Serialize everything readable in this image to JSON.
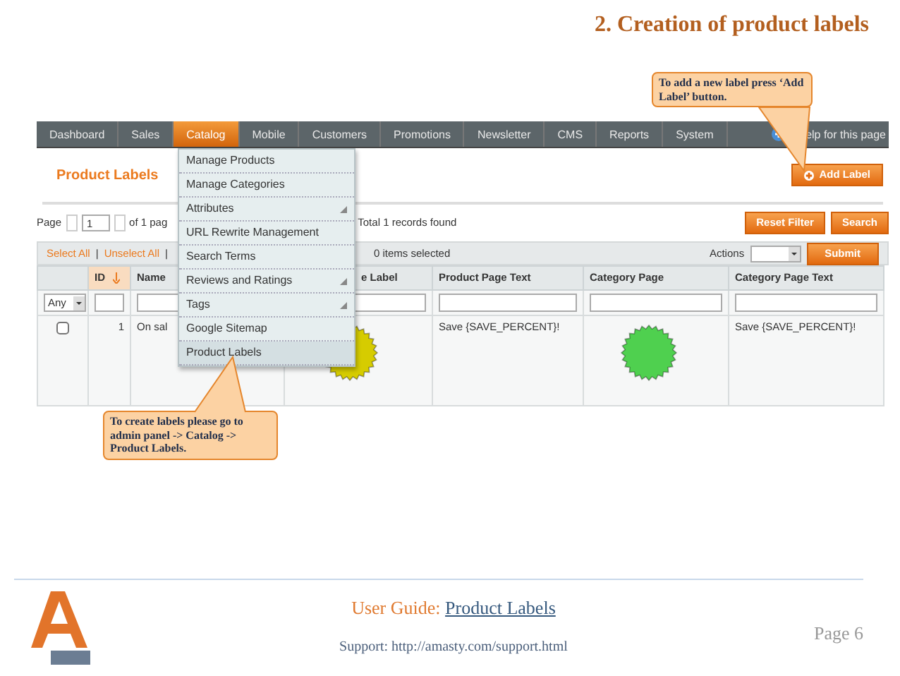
{
  "slide_title": "2. Creation of product labels",
  "admin": {
    "nav": [
      {
        "label": "Dashboard",
        "selected": false
      },
      {
        "label": "Sales",
        "selected": false
      },
      {
        "label": "Catalog",
        "selected": true
      },
      {
        "label": "Mobile",
        "selected": false
      },
      {
        "label": "Customers",
        "selected": false
      },
      {
        "label": "Promotions",
        "selected": false
      },
      {
        "label": "Newsletter",
        "selected": false
      },
      {
        "label": "CMS",
        "selected": false
      },
      {
        "label": "Reports",
        "selected": false
      },
      {
        "label": "System",
        "selected": false
      }
    ],
    "help_link": "elp for this page",
    "menu": [
      {
        "label": "Manage Products",
        "submenu": false,
        "selected": false
      },
      {
        "label": "Manage Categories",
        "submenu": false,
        "selected": false
      },
      {
        "label": "Attributes",
        "submenu": true,
        "selected": false
      },
      {
        "label": "URL Rewrite Management",
        "submenu": false,
        "selected": false
      },
      {
        "label": "Search Terms",
        "submenu": false,
        "selected": false
      },
      {
        "label": "Reviews and Ratings",
        "submenu": true,
        "selected": false
      },
      {
        "label": "Tags",
        "submenu": true,
        "selected": false
      },
      {
        "label": "Google Sitemap",
        "submenu": false,
        "selected": false
      },
      {
        "label": "Product Labels",
        "submenu": false,
        "selected": true
      }
    ],
    "page_title": "Product Labels",
    "add_button": "Add Label",
    "pager": {
      "page_label": "Page",
      "page_value": "1",
      "of_pages": "of 1 pag",
      "total": "Total 1 records found"
    },
    "filter_buttons": [
      "Reset Filter",
      "Search"
    ],
    "massaction": {
      "select_all": "Select All",
      "separator_1": "|",
      "unselect_all": "Unselect All",
      "separator_2": "|",
      "selected_count": "0 items selected",
      "actions_label": "Actions",
      "submit": "Submit"
    },
    "columns": [
      {
        "kind": "checkbox"
      },
      {
        "kind": "text",
        "label": "ID",
        "sorted": true
      },
      {
        "kind": "text",
        "label": "Name",
        "sorted": false
      },
      {
        "kind": "text",
        "label": "e Label",
        "sorted": false
      },
      {
        "kind": "text",
        "label": "Product Page Text",
        "sorted": false
      },
      {
        "kind": "text",
        "label": "Category Page",
        "sorted": false
      },
      {
        "kind": "text",
        "label": "Category Page Text",
        "sorted": false
      }
    ],
    "filter_any": "Any",
    "rows": [
      {
        "cells": [
          {
            "kind": "checkbox",
            "checked": false
          },
          {
            "kind": "number",
            "text": "1"
          },
          {
            "kind": "text",
            "text": "On sal"
          },
          {
            "kind": "badge",
            "color": "#d6cc00"
          },
          {
            "kind": "text",
            "text": "Save {SAVE_PERCENT}!"
          },
          {
            "kind": "badge",
            "color": "#4fd04f"
          },
          {
            "kind": "text",
            "text": "Save {SAVE_PERCENT}!"
          }
        ]
      }
    ]
  },
  "callouts": [
    {
      "text": "To add a new label press ‘Add Label’ button."
    },
    {
      "text": "To create labels please go to admin panel -> Catalog -> Product Labels."
    }
  ],
  "footer": {
    "guide_label": "User Guide:",
    "guide_link": "Product Labels",
    "support": "Support: http://amasty.com/support.html",
    "page": "Page 6"
  }
}
